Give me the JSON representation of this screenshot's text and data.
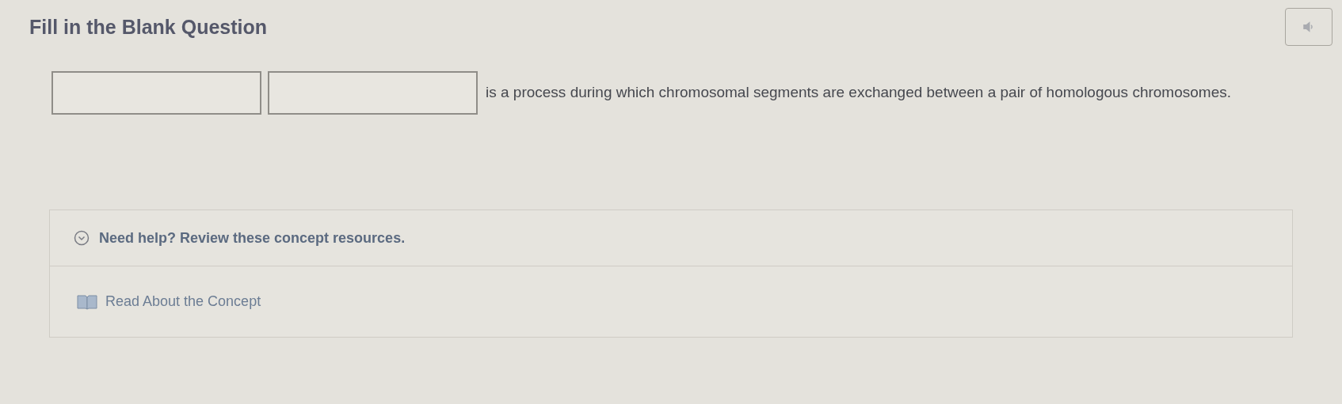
{
  "title": "Fill in the Blank Question",
  "question": {
    "blanks": [
      {
        "kind": "input"
      },
      {
        "kind": "input"
      }
    ],
    "text": "is a process during which chromosomal segments are exchanged between a pair of homologous chromosomes."
  },
  "help": {
    "label": "Need help? Review these concept resources.",
    "expanded": true,
    "resources": [
      {
        "label": "Read About the Concept"
      }
    ]
  }
}
